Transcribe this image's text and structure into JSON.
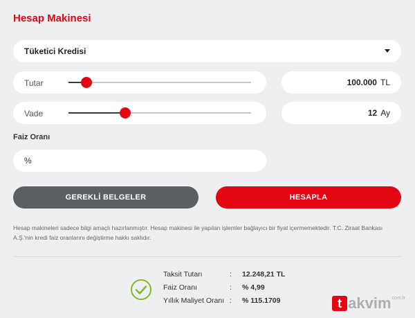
{
  "header": {
    "title": "Hesap Makinesi"
  },
  "loan_type": {
    "selected": "Tüketici Kredisi"
  },
  "amount": {
    "label": "Tutar",
    "slider_fraction": 0.1,
    "value": "100.000",
    "unit": "TL"
  },
  "term": {
    "label": "Vade",
    "slider_fraction": 0.31,
    "value": "12",
    "unit": "Ay"
  },
  "interest": {
    "label": "Faiz Oranı",
    "placeholder": "%"
  },
  "buttons": {
    "documents": "GEREKLİ BELGELER",
    "calculate": "HESAPLA"
  },
  "disclaimer": "Hesap makineleri sadece bilgi amaçlı hazırlanmıştır. Hesap makinesi ile yapılan işlemler bağlayıcı bir fiyat içermemektedir. T.C. Ziraat Bankası A.Ş.'nin kredi faiz oranlarını değiştirme hakkı saklıdır.",
  "results": [
    {
      "label": "Taksit Tutarı",
      "sep": ":",
      "value": "12.248,21 TL"
    },
    {
      "label": "Faiz Oranı",
      "sep": ":",
      "value": "% 4,99"
    },
    {
      "label": "Yıllık Maliyet Oranı",
      "sep": ":",
      "value": "% 115.1709"
    }
  ],
  "watermark": {
    "mark": "t",
    "text": "akvim",
    "tld": "com.tr"
  },
  "colors": {
    "accent": "#e30613",
    "dark_button": "#595f62",
    "success": "#7dbb2a"
  }
}
